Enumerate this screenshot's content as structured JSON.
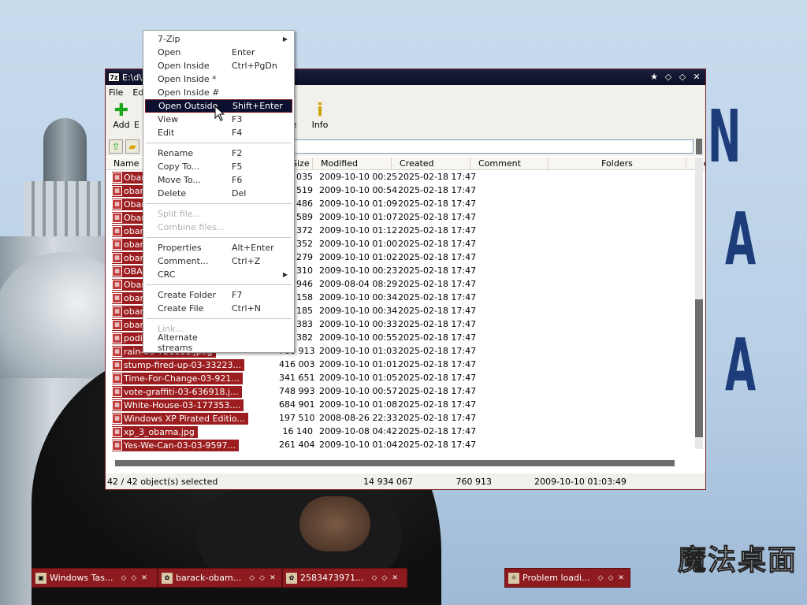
{
  "window": {
    "title": "E:\\d\\",
    "title_controls": [
      "★",
      "◇",
      "◇",
      "✕"
    ]
  },
  "menubar": {
    "items": [
      "File",
      "Edi"
    ]
  },
  "toolbar": {
    "add_label": "Add",
    "info_label": "Info",
    "b_label": "E",
    "e_label": "e"
  },
  "columns": [
    "Name",
    "Size",
    "Modified",
    "Created",
    "Comment",
    "Folders",
    "File"
  ],
  "files": [
    {
      "name": "Obam",
      "size": "035",
      "modified": "2009-10-10 00:25",
      "created": "2025-02-18 17:47"
    },
    {
      "name": "obam",
      "size": "519",
      "modified": "2009-10-10 00:54",
      "created": "2025-02-18 17:47"
    },
    {
      "name": "Obam",
      "size": "486",
      "modified": "2009-10-10 01:09",
      "created": "2025-02-18 17:47"
    },
    {
      "name": "Obam",
      "size": "589",
      "modified": "2009-10-10 01:07",
      "created": "2025-02-18 17:47"
    },
    {
      "name": "obam",
      "size": "372",
      "modified": "2009-10-10 01:12",
      "created": "2025-02-18 17:47"
    },
    {
      "name": "obam",
      "size": "352",
      "modified": "2009-10-10 01:00",
      "created": "2025-02-18 17:47"
    },
    {
      "name": "obam",
      "size": "279",
      "modified": "2009-10-10 01:02",
      "created": "2025-02-18 17:47"
    },
    {
      "name": "OBAM",
      "size": "310",
      "modified": "2009-10-10 00:23",
      "created": "2025-02-18 17:47"
    },
    {
      "name": "Obam",
      "size": "946",
      "modified": "2009-08-04 08:29",
      "created": "2025-02-18 17:47"
    },
    {
      "name": "obam",
      "size": "158",
      "modified": "2009-10-10 00:34",
      "created": "2025-02-18 17:47"
    },
    {
      "name": "obam",
      "size": "185",
      "modified": "2009-10-10 00:34",
      "created": "2025-02-18 17:47"
    },
    {
      "name": "obam",
      "size": "383",
      "modified": "2009-10-10 00:33",
      "created": "2025-02-18 17:47"
    },
    {
      "name": "podiu",
      "size": "382",
      "modified": "2009-10-10 00:55",
      "created": "2025-02-18 17:47"
    },
    {
      "name": "rain-03-721111.jpeg",
      "size": "760 913",
      "modified": "2009-10-10 01:03",
      "created": "2025-02-18 17:47"
    },
    {
      "name": "stump-fired-up-03-33223...",
      "size": "416 003",
      "modified": "2009-10-10 01:01",
      "created": "2025-02-18 17:47"
    },
    {
      "name": "Time-For-Change-03-921...",
      "size": "341 651",
      "modified": "2009-10-10 01:05",
      "created": "2025-02-18 17:47"
    },
    {
      "name": "vote-graffiti-03-636918.j...",
      "size": "748 993",
      "modified": "2009-10-10 00:57",
      "created": "2025-02-18 17:47"
    },
    {
      "name": "White-House-03-177353....",
      "size": "684 901",
      "modified": "2009-10-10 01:08",
      "created": "2025-02-18 17:47"
    },
    {
      "name": "Windows XP Pirated Editio...",
      "size": "197 510",
      "modified": "2008-08-26 22:33",
      "created": "2025-02-18 17:47"
    },
    {
      "name": "xp_3_obama.jpg",
      "size": "16 140",
      "modified": "2009-10-08 04:42",
      "created": "2025-02-18 17:47"
    },
    {
      "name": "Yes-We-Can-03-03-9597...",
      "size": "261 404",
      "modified": "2009-10-10 01:04",
      "created": "2025-02-18 17:47"
    }
  ],
  "status": {
    "selected": "42 / 42 object(s) selected",
    "total_size": "14 934 067",
    "selected_size": "760 913",
    "date": "2009-10-10 01:03:49"
  },
  "context_menu": {
    "groups": [
      [
        {
          "label": "7-Zip",
          "shortcut": "",
          "submenu": true,
          "disabled": false,
          "highlighted": false
        },
        {
          "label": "Open",
          "shortcut": "Enter",
          "submenu": false,
          "disabled": false,
          "highlighted": false
        },
        {
          "label": "Open Inside",
          "shortcut": "Ctrl+PgDn",
          "submenu": false,
          "disabled": false,
          "highlighted": false
        },
        {
          "label": "Open Inside *",
          "shortcut": "",
          "submenu": false,
          "disabled": false,
          "highlighted": false
        },
        {
          "label": "Open Inside #",
          "shortcut": "",
          "submenu": false,
          "disabled": false,
          "highlighted": false
        },
        {
          "label": "Open Outside",
          "shortcut": "Shift+Enter",
          "submenu": false,
          "disabled": false,
          "highlighted": true
        },
        {
          "label": "View",
          "shortcut": "F3",
          "submenu": false,
          "disabled": false,
          "highlighted": false
        },
        {
          "label": "Edit",
          "shortcut": "F4",
          "submenu": false,
          "disabled": false,
          "highlighted": false
        }
      ],
      [
        {
          "label": "Rename",
          "shortcut": "F2",
          "submenu": false,
          "disabled": false,
          "highlighted": false
        },
        {
          "label": "Copy To...",
          "shortcut": "F5",
          "submenu": false,
          "disabled": false,
          "highlighted": false
        },
        {
          "label": "Move To...",
          "shortcut": "F6",
          "submenu": false,
          "disabled": false,
          "highlighted": false
        },
        {
          "label": "Delete",
          "shortcut": "Del",
          "submenu": false,
          "disabled": false,
          "highlighted": false
        }
      ],
      [
        {
          "label": "Split file...",
          "shortcut": "",
          "submenu": false,
          "disabled": true,
          "highlighted": false
        },
        {
          "label": "Combine files...",
          "shortcut": "",
          "submenu": false,
          "disabled": true,
          "highlighted": false
        }
      ],
      [
        {
          "label": "Properties",
          "shortcut": "Alt+Enter",
          "submenu": false,
          "disabled": false,
          "highlighted": false
        },
        {
          "label": "Comment...",
          "shortcut": "Ctrl+Z",
          "submenu": false,
          "disabled": false,
          "highlighted": false
        },
        {
          "label": "CRC",
          "shortcut": "",
          "submenu": true,
          "disabled": false,
          "highlighted": false
        }
      ],
      [
        {
          "label": "Create Folder",
          "shortcut": "F7",
          "submenu": false,
          "disabled": false,
          "highlighted": false
        },
        {
          "label": "Create File",
          "shortcut": "Ctrl+N",
          "submenu": false,
          "disabled": false,
          "highlighted": false
        }
      ],
      [
        {
          "label": "Link...",
          "shortcut": "",
          "submenu": false,
          "disabled": true,
          "highlighted": false
        },
        {
          "label": "Alternate streams",
          "shortcut": "",
          "submenu": false,
          "disabled": false,
          "highlighted": false
        }
      ]
    ]
  },
  "taskbar": [
    {
      "label": "Windows Tas...",
      "icon": "monitor-icon"
    },
    {
      "label": "barack-obam...",
      "icon": "image-icon"
    },
    {
      "label": "2583473971...",
      "icon": "image-icon"
    },
    {
      "label": "Problem loadi...",
      "icon": "browser-icon"
    }
  ],
  "wallpaper": {
    "letters": [
      "N",
      "A",
      "A"
    ],
    "brand_text": "魔法桌面"
  },
  "colors": {
    "selection": "#9b1d1f",
    "titlebar": "#0b0e24",
    "taskbar": "#8d1a1e",
    "menu_highlight": "#0c1030"
  }
}
